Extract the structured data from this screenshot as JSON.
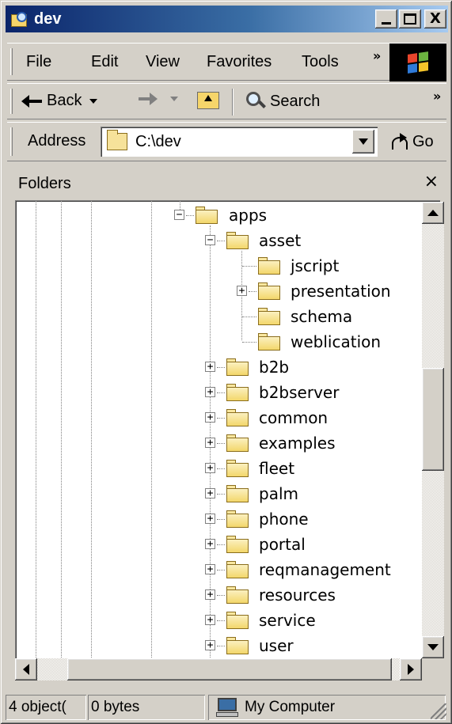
{
  "window": {
    "title": "dev",
    "icon": "explorer-folder-search-icon",
    "buttons": [
      "minimize-icon",
      "maximize-icon",
      "close-icon"
    ],
    "close_glyph": "X"
  },
  "menubar": {
    "items": [
      "File",
      "Edit",
      "View",
      "Favorites",
      "Tools"
    ],
    "overflow": "»"
  },
  "toolbar": {
    "back_label": "Back",
    "search_label": "Search",
    "overflow": "»"
  },
  "address": {
    "label": "Address",
    "value": "C:\\dev",
    "go_label": "Go"
  },
  "folders_pane": {
    "title": "Folders",
    "close_glyph": "×"
  },
  "tree": {
    "root": {
      "label": "apps",
      "expanded": true
    },
    "asset": {
      "label": "asset",
      "expanded": true
    },
    "asset_children": [
      "jscript",
      "presentation",
      "schema",
      "weblication"
    ],
    "apps_children": [
      "b2b",
      "b2bserver",
      "common",
      "examples",
      "fleet",
      "palm",
      "phone",
      "portal",
      "reqmanagement",
      "resources",
      "service",
      "user"
    ],
    "expander_collapsed": "+",
    "expander_expanded": "−"
  },
  "status": {
    "objects": "4 object(",
    "size": "0 bytes",
    "zone": "My Computer"
  },
  "colors": {
    "title_active": "#0a246a",
    "title_gradient_end": "#a6caf0",
    "chrome": "#d4d0c8",
    "folder": "#f3d76b"
  }
}
